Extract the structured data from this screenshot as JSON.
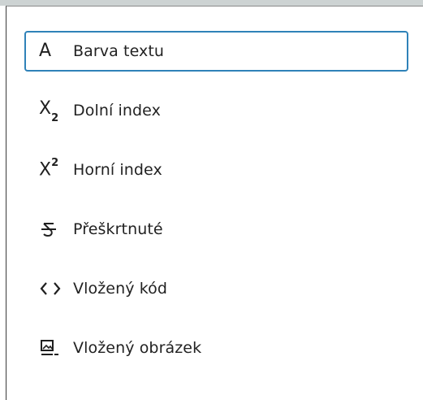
{
  "menu": {
    "items": [
      {
        "icon": "text-color-icon",
        "glyph": "A",
        "label": "Barva textu",
        "focused": true
      },
      {
        "icon": "subscript-icon",
        "glyph": "X",
        "glyph_index": "2",
        "label": "Dolní index",
        "focused": false
      },
      {
        "icon": "superscript-icon",
        "glyph": "X",
        "glyph_index": "2",
        "label": "Horní index",
        "focused": false
      },
      {
        "icon": "strikethrough-icon",
        "label": "Přeškrtnuté",
        "focused": false
      },
      {
        "icon": "inline-code-icon",
        "label": "Vložený kód",
        "focused": false
      },
      {
        "icon": "inline-image-icon",
        "label": "Vložený obrázek",
        "focused": false
      }
    ]
  },
  "colors": {
    "focus_border": "#2f82b8",
    "text": "#222222",
    "icon": "#1f1f1f"
  }
}
